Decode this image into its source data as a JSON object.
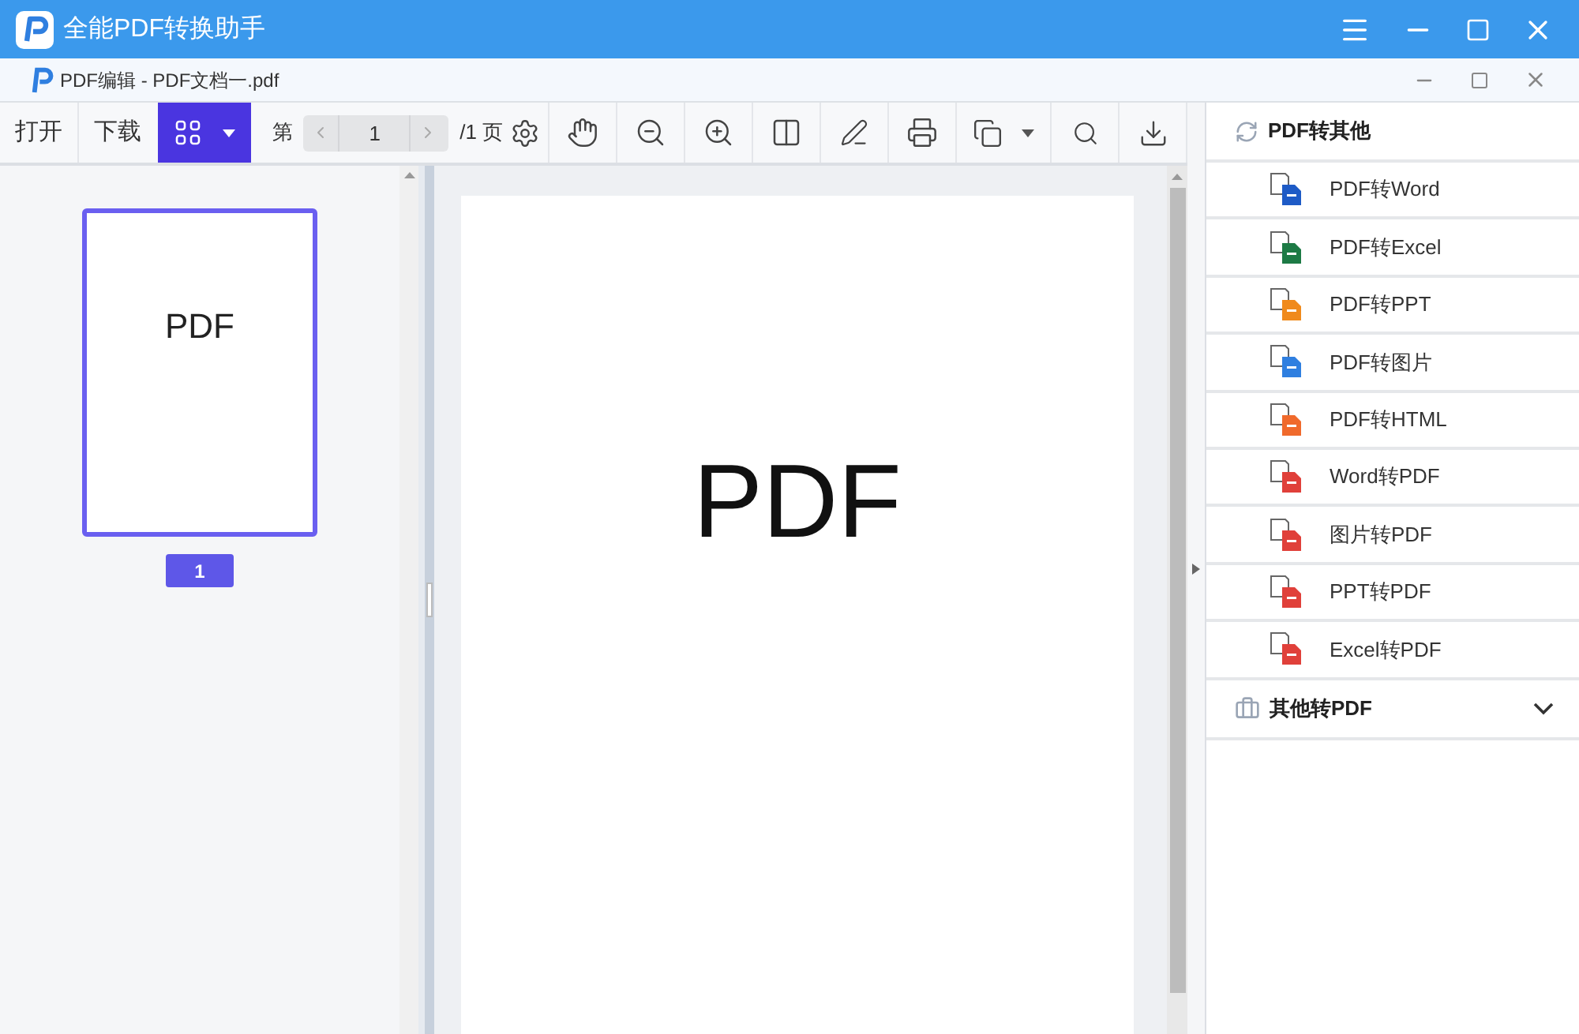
{
  "window": {
    "title": "全能PDF转换助手"
  },
  "document_tab": {
    "title": "PDF编辑 - PDF文档一.pdf"
  },
  "toolbar": {
    "open": "打开",
    "download": "下载",
    "page_prefix": "第",
    "page_value": "1",
    "page_suffix": "/1 页"
  },
  "thumbnails": [
    {
      "label": "PDF",
      "number": "1",
      "selected": true
    }
  ],
  "page": {
    "text": "PDF"
  },
  "sidebar": {
    "sections": [
      {
        "title": "PDF转其他",
        "expanded": true,
        "items": [
          {
            "label": "PDF转Word",
            "color": "#1e5bc6"
          },
          {
            "label": "PDF转Excel",
            "color": "#1d7a45"
          },
          {
            "label": "PDF转PPT",
            "color": "#f08a1c"
          },
          {
            "label": "PDF转图片",
            "color": "#2f7fe0"
          },
          {
            "label": "PDF转HTML",
            "color": "#f06a2c"
          },
          {
            "label": "Word转PDF",
            "color": "#e0403a"
          },
          {
            "label": "图片转PDF",
            "color": "#e0403a"
          },
          {
            "label": "PPT转PDF",
            "color": "#e0403a"
          },
          {
            "label": "Excel转PDF",
            "color": "#e0403a"
          }
        ]
      },
      {
        "title": "其他转PDF",
        "expanded": false
      }
    ]
  }
}
